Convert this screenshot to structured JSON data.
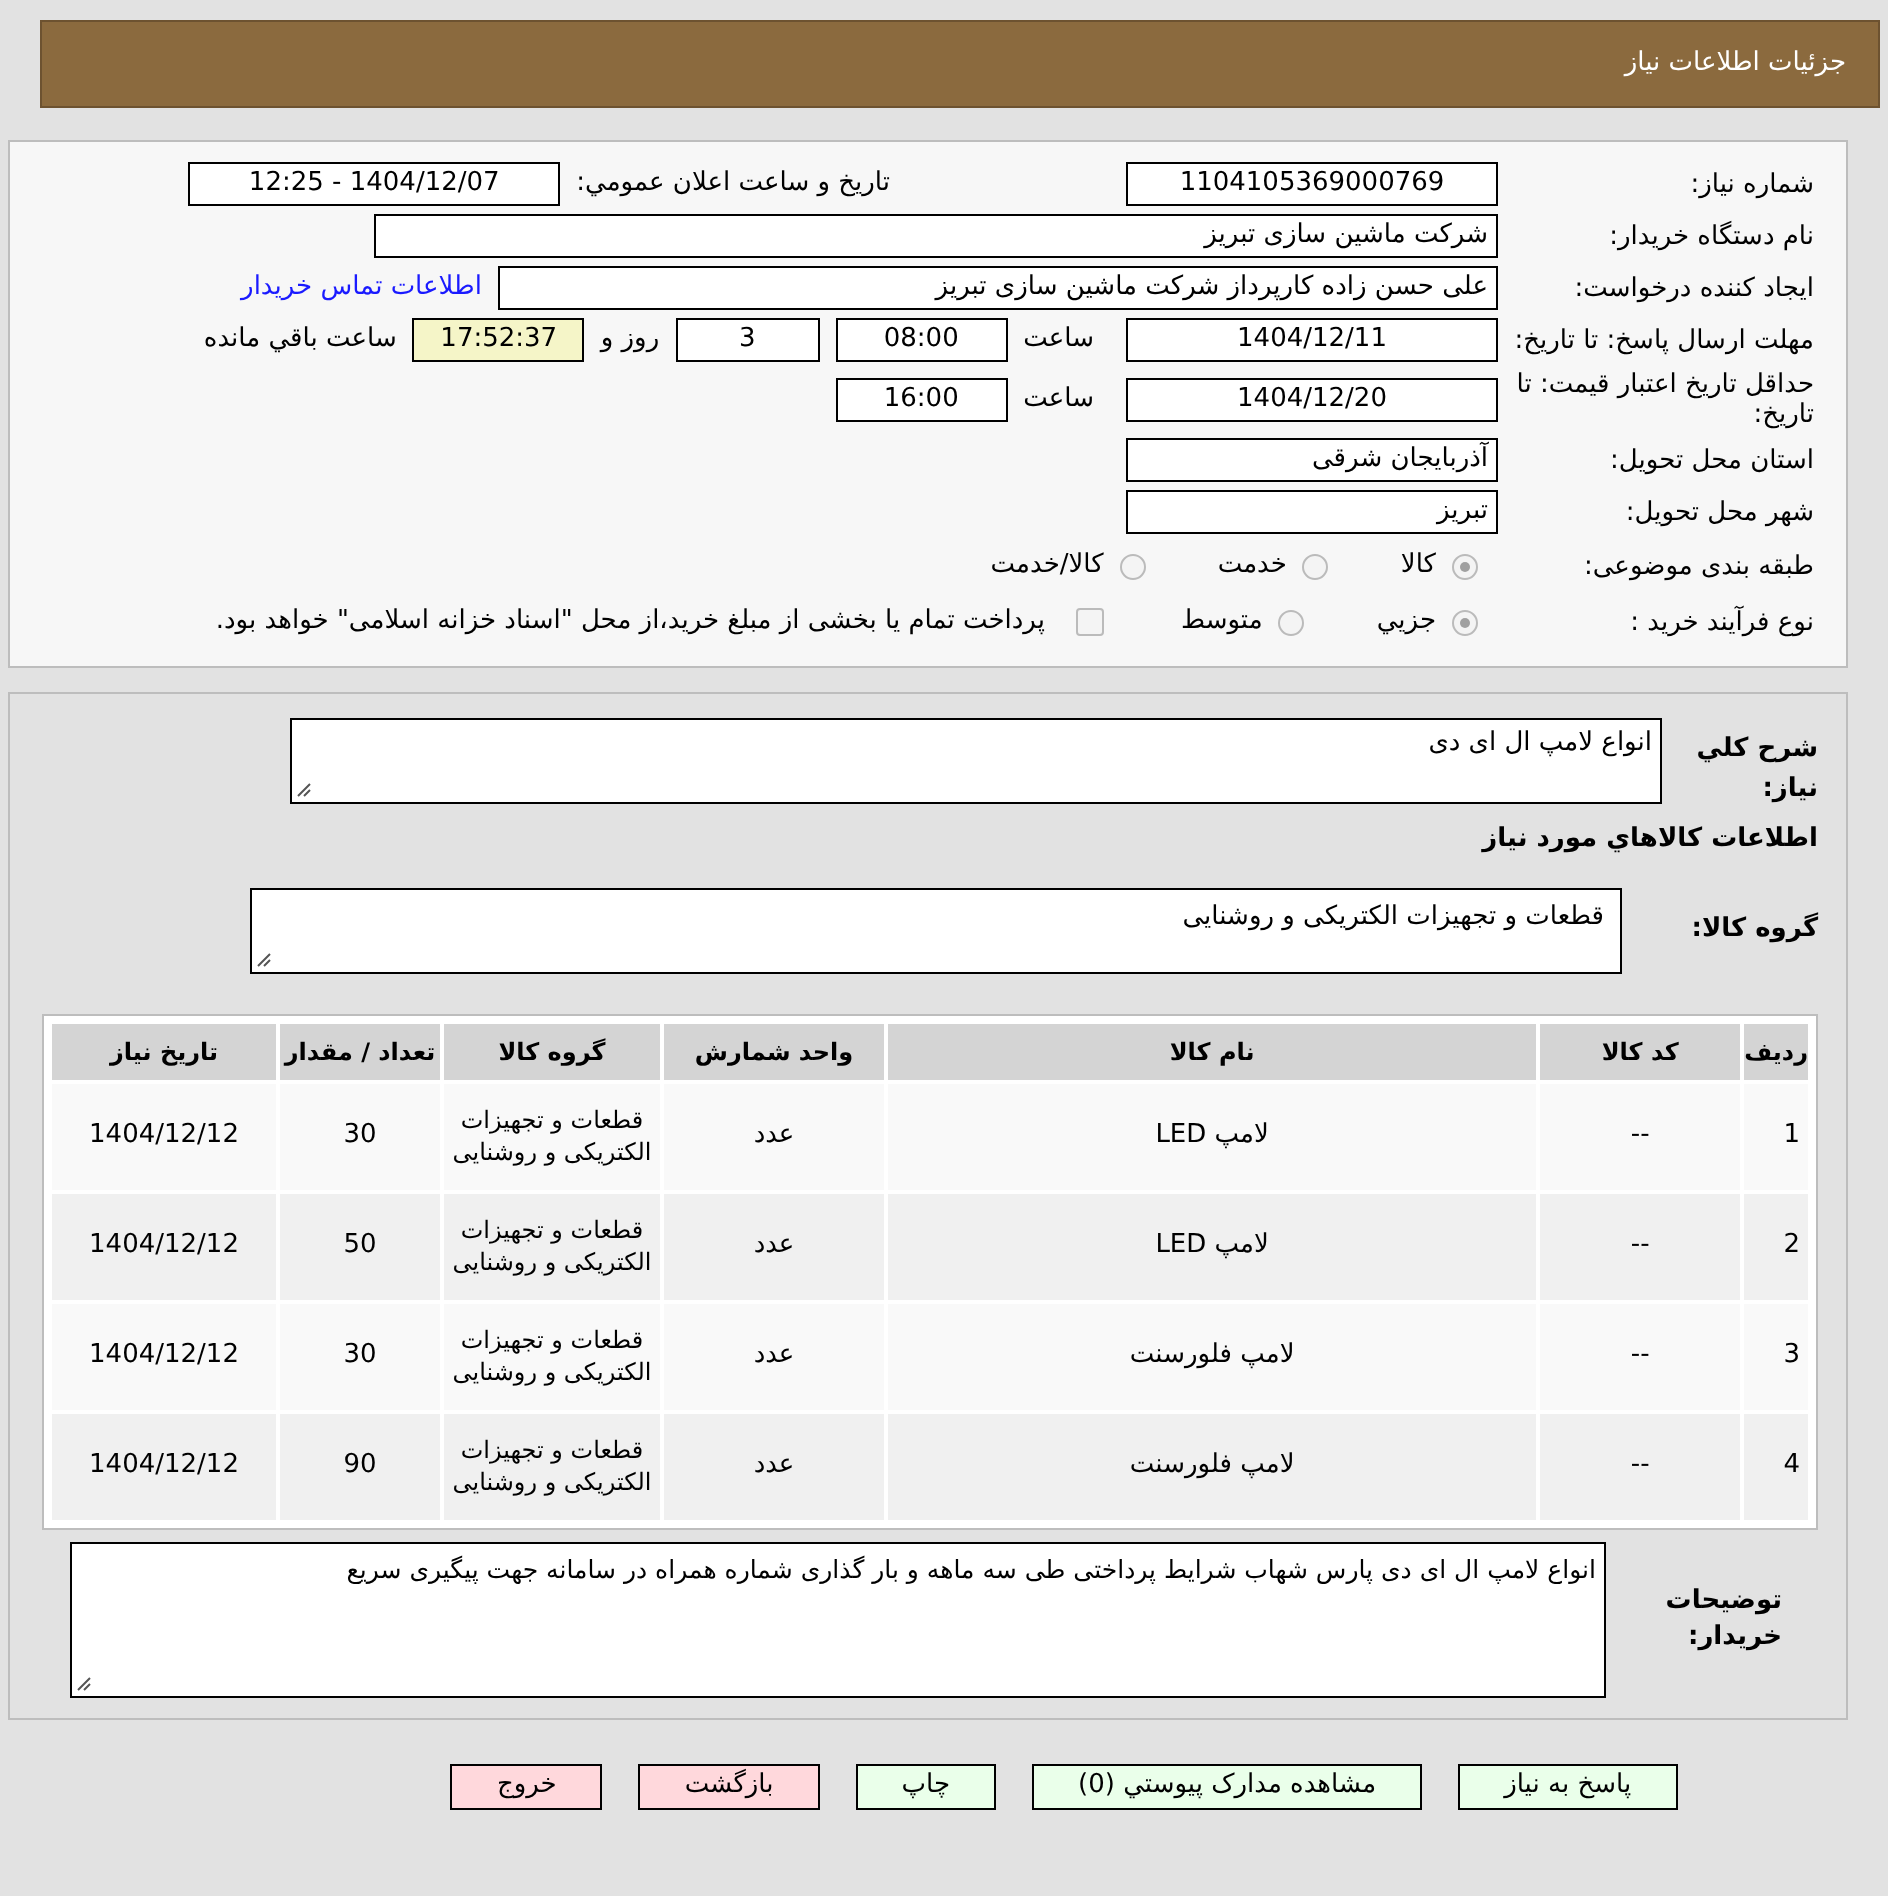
{
  "header": {
    "title": "جزئیات اطلاعات نیاز"
  },
  "details": {
    "need_number": {
      "label": "شماره نیاز:",
      "value": "1104105369000769"
    },
    "announce": {
      "label": "تاریخ و ساعت اعلان عمومي:",
      "value": "1404/12/07 - 12:25"
    },
    "buyer_org": {
      "label": "نام دستگاه خریدار:",
      "value": "شرکت ماشین سازی تبریز"
    },
    "requester": {
      "label": "ایجاد کننده درخواست:",
      "value": "علی حسن زاده کارپرداز شرکت ماشین سازی تبریز"
    },
    "contact_link": "اطلاعات تماس خریدار",
    "deadline": {
      "label": "مهلت ارسال پاسخ: تا تاریخ:",
      "date": "1404/12/11",
      "time_label": "ساعت",
      "time": "08:00",
      "days": "3",
      "days_label": "روز و",
      "remaining": "17:52:37",
      "remaining_label": "ساعت باقي مانده"
    },
    "validity": {
      "label": "حداقل تاریخ اعتبار قیمت: تا تاریخ:",
      "date": "1404/12/20",
      "time_label": "ساعت",
      "time": "16:00"
    },
    "province": {
      "label": "استان محل تحویل:",
      "value": "آذربایجان شرقی"
    },
    "city": {
      "label": "شهر محل تحویل:",
      "value": "تبریز"
    },
    "category": {
      "label": "طبقه بندی موضوعی:",
      "options": [
        {
          "label": "کالا",
          "selected": true
        },
        {
          "label": "خدمت",
          "selected": false
        },
        {
          "label": "کالا/خدمت",
          "selected": false
        }
      ]
    },
    "process": {
      "label": "نوع فرآیند خرید :",
      "options": [
        {
          "label": "جزيي",
          "selected": true
        },
        {
          "label": "متوسط",
          "selected": false
        }
      ],
      "payment_note": {
        "label": "پرداخت تمام یا بخشی از مبلغ خرید،از محل \"اسناد خزانه اسلامی\" خواهد بود.",
        "checked": false
      }
    }
  },
  "summary": {
    "label": "شرح کلي نیاز:",
    "value": "انواع لامپ ال ای دی"
  },
  "items_heading": "اطلاعات کالاهاي مورد نیاز",
  "goods_group": {
    "label": "گروه کالا:",
    "value": "قطعات و تجهیزات الکتریکی و روشنایی"
  },
  "table": {
    "columns": [
      "ردیف",
      "کد کالا",
      "نام کالا",
      "واحد شمارش",
      "گروه کالا",
      "تعداد / مقدار",
      "تاریخ نیاز"
    ],
    "rows": [
      [
        "1",
        "--",
        "لامپ LED",
        "عدد",
        "قطعات و تجهیزات الکتریکی و روشنایی",
        "30",
        "1404/12/12"
      ],
      [
        "2",
        "--",
        "لامپ LED",
        "عدد",
        "قطعات و تجهیزات الکتریکی و روشنایی",
        "50",
        "1404/12/12"
      ],
      [
        "3",
        "--",
        "لامپ فلورسنت",
        "عدد",
        "قطعات و تجهیزات الکتریکی و روشنایی",
        "30",
        "1404/12/12"
      ],
      [
        "4",
        "--",
        "لامپ فلورسنت",
        "عدد",
        "قطعات و تجهیزات الکتریکی و روشنایی",
        "90",
        "1404/12/12"
      ]
    ]
  },
  "buyer_notes": {
    "label": "توضیحات خریدار:",
    "value": "انواع لامپ ال ای دی پارس شهاب شرایط پرداختی طی سه ماهه و بار گذاری شماره همراه در سامانه جهت پیگیری سریع"
  },
  "buttons": [
    {
      "label": "پاسخ به نیاز",
      "kind": "primary"
    },
    {
      "label": "مشاهده مدارک پیوستي (0)",
      "kind": "primary"
    },
    {
      "label": "چاپ",
      "kind": "primary"
    },
    {
      "label": "بازگشت",
      "kind": "danger"
    },
    {
      "label": "خروج",
      "kind": "danger"
    }
  ]
}
